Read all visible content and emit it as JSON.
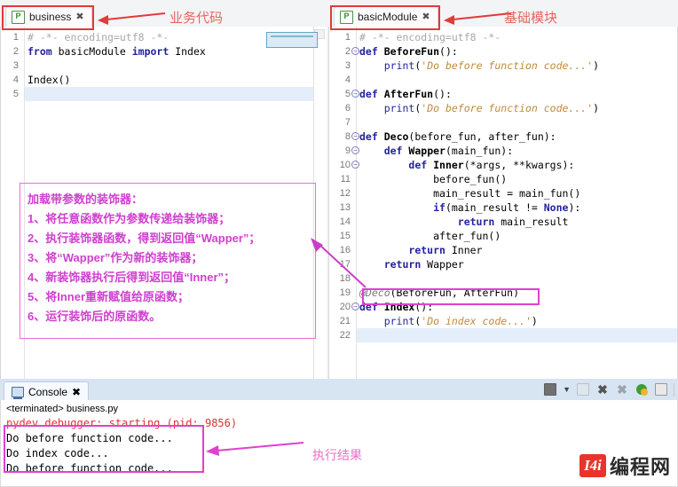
{
  "editors": [
    {
      "tab": {
        "label": "business",
        "icon": "python-file-icon",
        "close": "✖"
      },
      "annotation": {
        "text": "业务代码",
        "color": "#e8655f"
      },
      "lines": [
        {
          "n": "1",
          "fold": false,
          "segments": [
            {
              "cls": "cmt",
              "t": "# -*- encoding=utf8 -*-"
            }
          ]
        },
        {
          "n": "2",
          "fold": false,
          "segments": [
            {
              "cls": "kw",
              "t": "from"
            },
            {
              "cls": "pln",
              "t": " basicModule "
            },
            {
              "cls": "kw",
              "t": "import"
            },
            {
              "cls": "pln",
              "t": " Index"
            }
          ]
        },
        {
          "n": "3",
          "fold": false,
          "segments": []
        },
        {
          "n": "4",
          "fold": false,
          "segments": [
            {
              "cls": "pln",
              "t": "Index()"
            }
          ]
        },
        {
          "n": "5",
          "fold": false,
          "highlight": true,
          "segments": []
        }
      ]
    },
    {
      "tab": {
        "label": "basicModule",
        "icon": "python-file-icon",
        "close": "✖"
      },
      "annotation": {
        "text": "基础模块",
        "color": "#e8655f"
      },
      "lines": [
        {
          "n": "1",
          "fold": false,
          "segments": [
            {
              "cls": "cmt",
              "t": "# -*- encoding=utf8 -*-"
            }
          ]
        },
        {
          "n": "2",
          "fold": true,
          "segments": [
            {
              "cls": "kw",
              "t": "def"
            },
            {
              "cls": "pln",
              "t": " "
            },
            {
              "cls": "fn",
              "t": "BeforeFun"
            },
            {
              "cls": "pln",
              "t": "():"
            }
          ]
        },
        {
          "n": "3",
          "fold": false,
          "segments": [
            {
              "cls": "pln",
              "t": "    "
            },
            {
              "cls": "kw2",
              "t": "print"
            },
            {
              "cls": "pln",
              "t": "("
            },
            {
              "cls": "str",
              "t": "'Do before function code...'"
            },
            {
              "cls": "pln",
              "t": ")"
            }
          ]
        },
        {
          "n": "4",
          "fold": false,
          "segments": []
        },
        {
          "n": "5",
          "fold": true,
          "segments": [
            {
              "cls": "kw",
              "t": "def"
            },
            {
              "cls": "pln",
              "t": " "
            },
            {
              "cls": "fn",
              "t": "AfterFun"
            },
            {
              "cls": "pln",
              "t": "():"
            }
          ]
        },
        {
          "n": "6",
          "fold": false,
          "segments": [
            {
              "cls": "pln",
              "t": "    "
            },
            {
              "cls": "kw2",
              "t": "print"
            },
            {
              "cls": "pln",
              "t": "("
            },
            {
              "cls": "str",
              "t": "'Do before function code...'"
            },
            {
              "cls": "pln",
              "t": ")"
            }
          ]
        },
        {
          "n": "7",
          "fold": false,
          "segments": []
        },
        {
          "n": "8",
          "fold": true,
          "segments": [
            {
              "cls": "kw",
              "t": "def"
            },
            {
              "cls": "pln",
              "t": " "
            },
            {
              "cls": "fn",
              "t": "Deco"
            },
            {
              "cls": "pln",
              "t": "(before_fun, after_fun):"
            }
          ]
        },
        {
          "n": "9",
          "fold": true,
          "segments": [
            {
              "cls": "pln",
              "t": "    "
            },
            {
              "cls": "kw",
              "t": "def"
            },
            {
              "cls": "pln",
              "t": " "
            },
            {
              "cls": "fn",
              "t": "Wapper"
            },
            {
              "cls": "pln",
              "t": "(main_fun):"
            }
          ]
        },
        {
          "n": "10",
          "fold": true,
          "segments": [
            {
              "cls": "pln",
              "t": "        "
            },
            {
              "cls": "kw",
              "t": "def"
            },
            {
              "cls": "pln",
              "t": " "
            },
            {
              "cls": "fn",
              "t": "Inner"
            },
            {
              "cls": "pln",
              "t": "(*args, **kwargs):"
            }
          ]
        },
        {
          "n": "11",
          "fold": false,
          "segments": [
            {
              "cls": "pln",
              "t": "            before_fun()"
            }
          ]
        },
        {
          "n": "12",
          "fold": false,
          "segments": [
            {
              "cls": "pln",
              "t": "            main_result = main_fun()"
            }
          ]
        },
        {
          "n": "13",
          "fold": false,
          "segments": [
            {
              "cls": "pln",
              "t": "            "
            },
            {
              "cls": "kw",
              "t": "if"
            },
            {
              "cls": "pln",
              "t": "(main_result != "
            },
            {
              "cls": "kw",
              "t": "None"
            },
            {
              "cls": "pln",
              "t": "):"
            }
          ]
        },
        {
          "n": "14",
          "fold": false,
          "segments": [
            {
              "cls": "pln",
              "t": "                "
            },
            {
              "cls": "kw",
              "t": "return"
            },
            {
              "cls": "pln",
              "t": " main_result"
            }
          ]
        },
        {
          "n": "15",
          "fold": false,
          "segments": [
            {
              "cls": "pln",
              "t": "            after_fun()"
            }
          ]
        },
        {
          "n": "16",
          "fold": false,
          "segments": [
            {
              "cls": "pln",
              "t": "        "
            },
            {
              "cls": "kw",
              "t": "return"
            },
            {
              "cls": "pln",
              "t": " Inner"
            }
          ]
        },
        {
          "n": "17",
          "fold": false,
          "segments": [
            {
              "cls": "pln",
              "t": "    "
            },
            {
              "cls": "kw",
              "t": "return"
            },
            {
              "cls": "pln",
              "t": " Wapper"
            }
          ]
        },
        {
          "n": "18",
          "fold": false,
          "segments": []
        },
        {
          "n": "19",
          "fold": false,
          "boxed": true,
          "segments": [
            {
              "cls": "dec",
              "t": "@Deco"
            },
            {
              "cls": "pln",
              "t": "(BeforeFun, AfterFun)"
            }
          ]
        },
        {
          "n": "20",
          "fold": true,
          "segments": [
            {
              "cls": "kw",
              "t": "def"
            },
            {
              "cls": "pln",
              "t": " "
            },
            {
              "cls": "fn",
              "t": "Index"
            },
            {
              "cls": "pln",
              "t": "():"
            }
          ]
        },
        {
          "n": "21",
          "fold": false,
          "segments": [
            {
              "cls": "pln",
              "t": "    "
            },
            {
              "cls": "kw2",
              "t": "print"
            },
            {
              "cls": "pln",
              "t": "("
            },
            {
              "cls": "str",
              "t": "'Do index code...'"
            },
            {
              "cls": "pln",
              "t": ")"
            }
          ]
        },
        {
          "n": "22",
          "fold": false,
          "highlight": true,
          "segments": []
        }
      ]
    }
  ],
  "note": {
    "lines": [
      "加载带参数的装饰器：",
      "1、将任意函数作为参数传递给装饰器；",
      "2、执行装饰器函数，得到返回值“Wapper”；",
      "3、将“Wapper”作为新的装饰器；",
      "4、新装饰器执行后得到返回值“Inner”；",
      "5、将Inner重新赋值给原函数；",
      "6、运行装饰后的原函数。"
    ],
    "color": "#cf3fcf"
  },
  "console": {
    "tab": {
      "label": "Console",
      "icon": "console-icon",
      "close": "✖"
    },
    "toolbar": [
      {
        "name": "display-selected-console-icon",
        "type": "box-caret",
        "disabled": false
      },
      {
        "name": "pin-console-icon",
        "type": "box",
        "disabled": true
      },
      {
        "name": "terminate-icon",
        "type": "x",
        "disabled": false
      },
      {
        "name": "remove-all-terminated-icon",
        "type": "xx",
        "disabled": true
      },
      {
        "name": "open-console-icon",
        "type": "green-plus",
        "disabled": false
      },
      {
        "name": "new-console-view-icon",
        "type": "windows",
        "disabled": false
      }
    ],
    "status": "<terminated> business.py",
    "output": [
      {
        "text": "pydev debugger: starting (pid: 9856)",
        "error": true
      },
      {
        "text": "Do before function code...",
        "error": false
      },
      {
        "text": "Do index code...",
        "error": false
      },
      {
        "text": "Do before function code...",
        "error": false
      }
    ],
    "annotation": {
      "text": "执行结果",
      "color": "#ee6fc8"
    }
  },
  "logo": {
    "mark": "I4i",
    "text": "编程网"
  }
}
